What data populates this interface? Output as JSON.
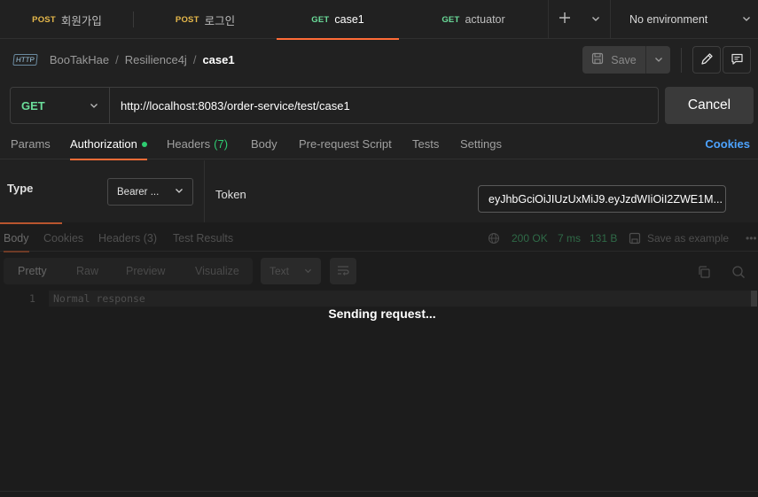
{
  "tabs": [
    {
      "method": "POST",
      "label": "회원가입",
      "active": false
    },
    {
      "method": "POST",
      "label": "로그인",
      "active": false
    },
    {
      "method": "GET",
      "label": "case1",
      "active": true
    },
    {
      "method": "GET",
      "label": "actuator",
      "active": false
    }
  ],
  "environment": {
    "label": "No environment"
  },
  "breadcrumb": {
    "icon_text": "HTTP",
    "collection": "BooTakHae",
    "folder": "Resilience4j",
    "request": "case1"
  },
  "toolbar": {
    "save_label": "Save"
  },
  "request": {
    "method": "GET",
    "url": "http://localhost:8083/order-service/test/case1",
    "cancel_label": "Cancel"
  },
  "request_tabs": {
    "params": "Params",
    "authorization": "Authorization",
    "headers": "Headers",
    "headers_count": "(7)",
    "body": "Body",
    "prerequest": "Pre-request Script",
    "tests": "Tests",
    "settings": "Settings",
    "cookies": "Cookies"
  },
  "auth": {
    "type_label": "Type",
    "type_value": "Bearer ...",
    "token_label": "Token",
    "token_value": "eyJhbGciOiJIUzUxMiJ9.eyJzdWIiOiI2ZWE1M..."
  },
  "response_tabs": {
    "body": "Body",
    "cookies": "Cookies",
    "headers": "Headers (3)",
    "test_results": "Test Results"
  },
  "response_meta": {
    "status": "200 OK",
    "time": "7 ms",
    "size": "131 B",
    "save_example": "Save as example"
  },
  "format": {
    "pretty": "Pretty",
    "raw": "Raw",
    "preview": "Preview",
    "visualize": "Visualize",
    "type": "Text"
  },
  "editor": {
    "line_number": "1",
    "content": "Normal response"
  },
  "overlay": {
    "message": "Sending request..."
  },
  "colors": {
    "accent": "#ff6c37",
    "get": "#6bdd9a",
    "post": "#e7b94b",
    "link": "#4da3ff",
    "success": "#2ecc71"
  }
}
